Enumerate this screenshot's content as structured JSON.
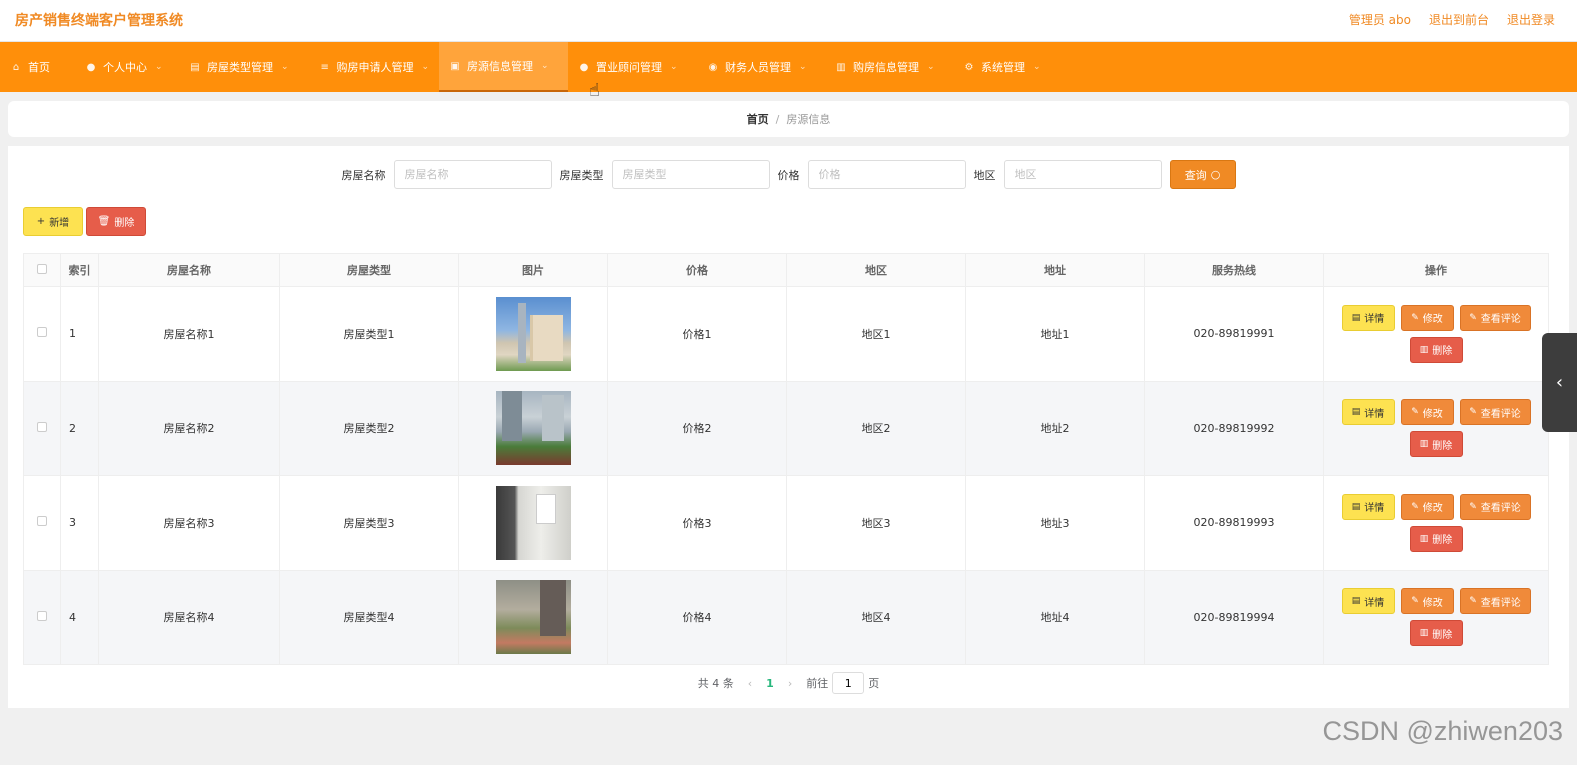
{
  "header": {
    "title": "房产销售终端客户管理系统",
    "user": "管理员 abo",
    "front": "退出到前台",
    "logout": "退出登录"
  },
  "nav": [
    {
      "label": "首页",
      "icon": "home-icon",
      "active": false,
      "chevron": false
    },
    {
      "label": "个人中心",
      "icon": "user-icon",
      "active": false,
      "chevron": true
    },
    {
      "label": "房屋类型管理",
      "icon": "doc-icon",
      "active": false,
      "chevron": true
    },
    {
      "label": "购房申请人管理",
      "icon": "list-icon",
      "active": false,
      "chevron": true
    },
    {
      "label": "房源信息管理",
      "icon": "clipboard-icon",
      "active": true,
      "chevron": true
    },
    {
      "label": "置业顾问管理",
      "icon": "user-icon",
      "active": false,
      "chevron": true
    },
    {
      "label": "财务人员管理",
      "icon": "money-icon",
      "active": false,
      "chevron": true
    },
    {
      "label": "购房信息管理",
      "icon": "chart-icon",
      "active": false,
      "chevron": true
    },
    {
      "label": "系统管理",
      "icon": "gear-icon",
      "active": false,
      "chevron": true
    }
  ],
  "breadcrumb": {
    "home": "首页",
    "current": "房源信息"
  },
  "search": {
    "name_label": "房屋名称",
    "name_placeholder": "房屋名称",
    "type_label": "房屋类型",
    "type_placeholder": "房屋类型",
    "price_label": "价格",
    "price_placeholder": "价格",
    "region_label": "地区",
    "region_placeholder": "地区",
    "query_label": "查询"
  },
  "actions": {
    "add": "新增",
    "delete": "删除"
  },
  "table": {
    "headers": [
      "索引",
      "房屋名称",
      "房屋类型",
      "图片",
      "价格",
      "地区",
      "地址",
      "服务热线",
      "操作"
    ],
    "rows": [
      {
        "index": "1",
        "name": "房屋名称1",
        "type": "房屋类型1",
        "price": "价格1",
        "region": "地区1",
        "address": "地址1",
        "hotline": "020-89819991"
      },
      {
        "index": "2",
        "name": "房屋名称2",
        "type": "房屋类型2",
        "price": "价格2",
        "region": "地区2",
        "address": "地址2",
        "hotline": "020-89819992"
      },
      {
        "index": "3",
        "name": "房屋名称3",
        "type": "房屋类型3",
        "price": "价格3",
        "region": "地区3",
        "address": "地址3",
        "hotline": "020-89819993"
      },
      {
        "index": "4",
        "name": "房屋名称4",
        "type": "房屋类型4",
        "price": "价格4",
        "region": "地区4",
        "address": "地址4",
        "hotline": "020-89819994"
      }
    ],
    "ops": {
      "detail": "详情",
      "edit": "修改",
      "comment": "查看评论",
      "delete": "删除"
    }
  },
  "pagination": {
    "total": "共 4 条",
    "current": "1",
    "goto_prefix": "前往",
    "goto_value": "1",
    "goto_suffix": "页"
  },
  "watermark": "CSDN @zhiwen203",
  "colors": {
    "nav_bg": "#ff8f0a",
    "accent": "#f08a24",
    "yellow_btn": "#fde251",
    "red_btn": "#e65d4a"
  }
}
